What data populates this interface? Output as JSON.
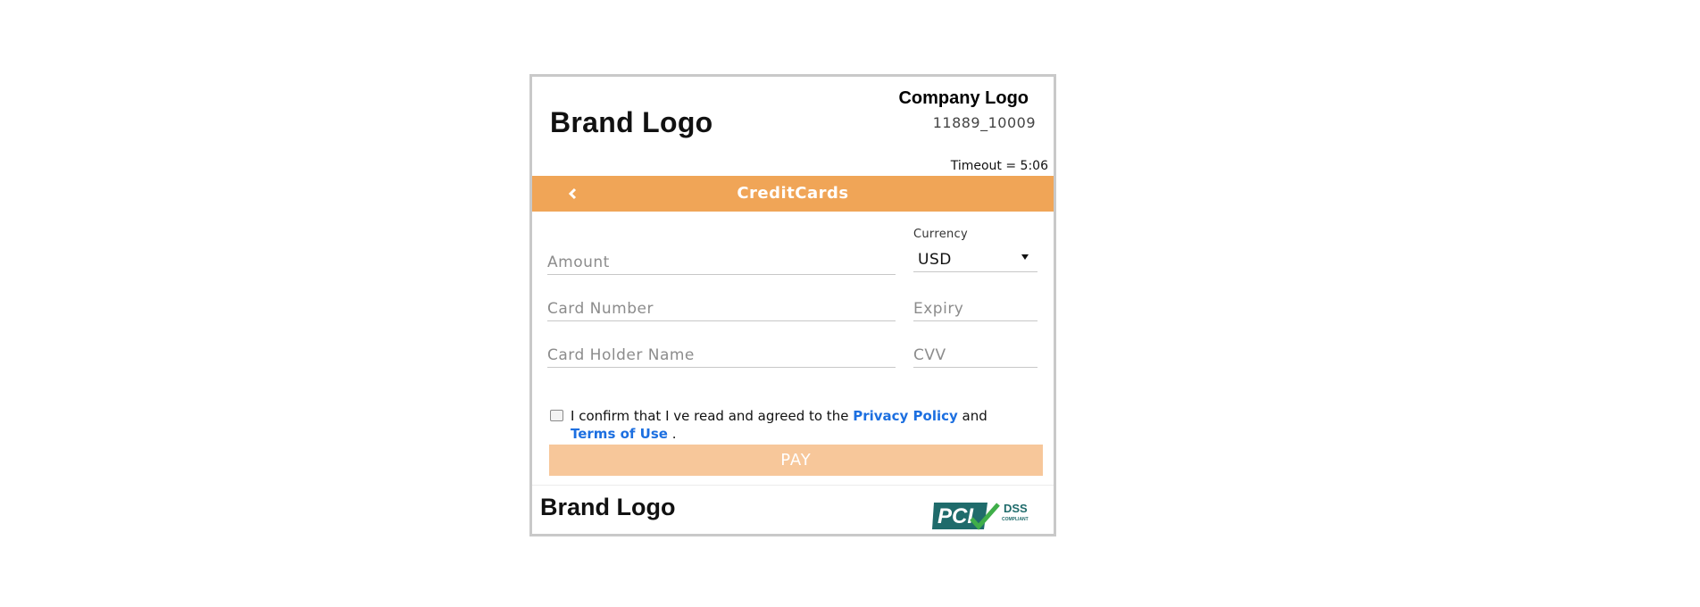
{
  "header": {
    "brand_logo": "Brand Logo",
    "company_logo": "Company Logo",
    "merchant_id": "11889_10009",
    "timeout": "Timeout = 5:06",
    "title": "CreditCards",
    "back_icon": "chevron-left-icon"
  },
  "form": {
    "amount_placeholder": "Amount",
    "currency_label": "Currency",
    "currency_value": "USD",
    "card_number_placeholder": "Card Number",
    "expiry_placeholder": "Expiry",
    "card_holder_placeholder": "Card Holder Name",
    "cvv_placeholder": "CVV"
  },
  "consent": {
    "checked": false,
    "prefix": "I confirm that I ve read and agreed to the ",
    "privacy_link": "Privacy Policy",
    "middle": " and ",
    "terms_link": "Terms of Use",
    "suffix": " ."
  },
  "pay_button": "PAY",
  "footer": {
    "brand_logo": "Brand Logo",
    "pci_logo_text": "PCI DSS COMPLIANT",
    "pci_icon": "pci-dss-compliant-logo"
  },
  "colors": {
    "accent": "#f0a557",
    "pay_button_disabled": "#f7c79a",
    "link": "#1c6fe0",
    "pci_teal": "#1f6b6b",
    "pci_check": "#3fae49"
  }
}
